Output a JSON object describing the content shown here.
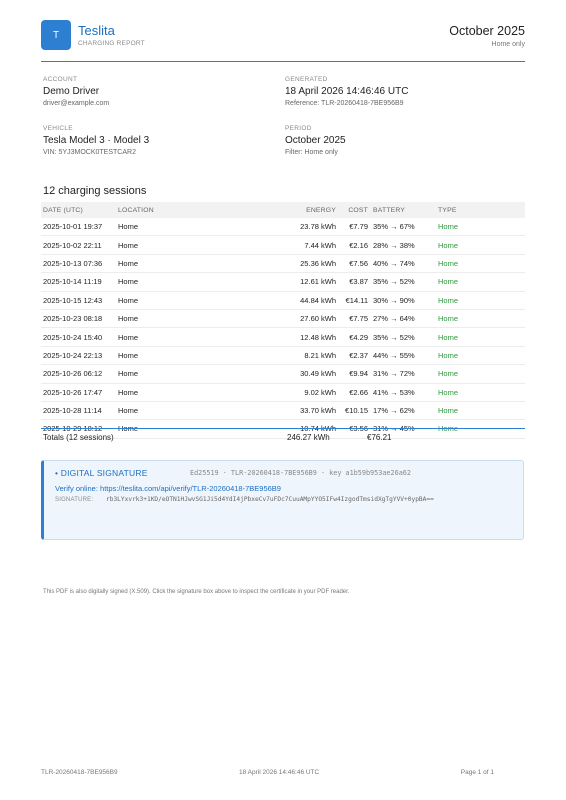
{
  "header": {
    "logo_letter": "T",
    "brand": "Teslita",
    "subtitle": "CHARGING REPORT",
    "period": "October 2025",
    "filter": "Home only"
  },
  "meta": {
    "account": {
      "label": "ACCOUNT",
      "name": "Demo Driver",
      "email": "driver@example.com"
    },
    "generated": {
      "label": "GENERATED",
      "value": "18 April 2026 14:46:46 UTC",
      "reference": "Reference: TLR-20260418-7BE956B9"
    },
    "vehicle": {
      "label": "VEHICLE",
      "name": "Tesla Model 3 · Model 3",
      "vin": "VIN: 5YJ3MOCK0TESTCAR2"
    },
    "period": {
      "label": "PERIOD",
      "value": "October 2025",
      "filter": "Filter: Home only"
    }
  },
  "sessions": {
    "title": "12 charging sessions",
    "columns": {
      "date": "DATE (UTC)",
      "location": "LOCATION",
      "energy": "ENERGY",
      "cost": "COST",
      "battery": "BATTERY",
      "type": "TYPE"
    },
    "rows": [
      {
        "date": "2025-10-01 19:37",
        "location": "Home",
        "energy": "23.78 kWh",
        "cost": "€7.79",
        "battery": "35% → 67%",
        "type": "Home"
      },
      {
        "date": "2025-10-02 22:11",
        "location": "Home",
        "energy": "7.44 kWh",
        "cost": "€2.16",
        "battery": "28% → 38%",
        "type": "Home"
      },
      {
        "date": "2025-10-13 07:36",
        "location": "Home",
        "energy": "25.36 kWh",
        "cost": "€7.56",
        "battery": "40% → 74%",
        "type": "Home"
      },
      {
        "date": "2025-10-14 11:19",
        "location": "Home",
        "energy": "12.61 kWh",
        "cost": "€3.87",
        "battery": "35% → 52%",
        "type": "Home"
      },
      {
        "date": "2025-10-15 12:43",
        "location": "Home",
        "energy": "44.84 kWh",
        "cost": "€14.11",
        "battery": "30% → 90%",
        "type": "Home"
      },
      {
        "date": "2025-10-23 08:18",
        "location": "Home",
        "energy": "27.60 kWh",
        "cost": "€7.75",
        "battery": "27% → 64%",
        "type": "Home"
      },
      {
        "date": "2025-10-24 15:40",
        "location": "Home",
        "energy": "12.48 kWh",
        "cost": "€4.29",
        "battery": "35% → 52%",
        "type": "Home"
      },
      {
        "date": "2025-10-24 22:13",
        "location": "Home",
        "energy": "8.21 kWh",
        "cost": "€2.37",
        "battery": "44% → 55%",
        "type": "Home"
      },
      {
        "date": "2025-10-26 06:12",
        "location": "Home",
        "energy": "30.49 kWh",
        "cost": "€9.94",
        "battery": "31% → 72%",
        "type": "Home"
      },
      {
        "date": "2025-10-26 17:47",
        "location": "Home",
        "energy": "9.02 kWh",
        "cost": "€2.66",
        "battery": "41% → 53%",
        "type": "Home"
      },
      {
        "date": "2025-10-28 11:14",
        "location": "Home",
        "energy": "33.70 kWh",
        "cost": "€10.15",
        "battery": "17% → 62%",
        "type": "Home"
      },
      {
        "date": "2025-10-29 18:12",
        "location": "Home",
        "energy": "10.74 kWh",
        "cost": "€3.56",
        "battery": "31% → 45%",
        "type": "Home"
      }
    ],
    "totals": {
      "label": "Totals (12 sessions)",
      "energy": "246.27 kWh",
      "cost": "€76.21"
    }
  },
  "signature": {
    "title": "• DIGITAL SIGNATURE",
    "meta": "Ed25519 · TLR-20260418-7BE956B9 · key a1b59b953ae26a62",
    "verify": "Verify online: https://teslita.com/api/verify/TLR-20260418-7BE956B9",
    "label": "SIGNATURE:",
    "value": "rb3LYxvrk3+1KD/eOTN1HJwvSG1Ji5d4YdI4jPbxeCv7uFDc7CuuAMpYYO5IFw4IzgodTmsidXgTgYVV+0ypBA=="
  },
  "footnote": "This PDF is also digitally signed (X.509). Click the signature box above to inspect the certificate in your PDF reader.",
  "footer": {
    "reference": "TLR-20260418-7BE956B9",
    "timestamp": "18 April 2026 14:46:46 UTC",
    "page": "Page 1 of 1"
  },
  "colors": {
    "accent": "#2d7fd1",
    "type_home": "#2e9b3e"
  }
}
